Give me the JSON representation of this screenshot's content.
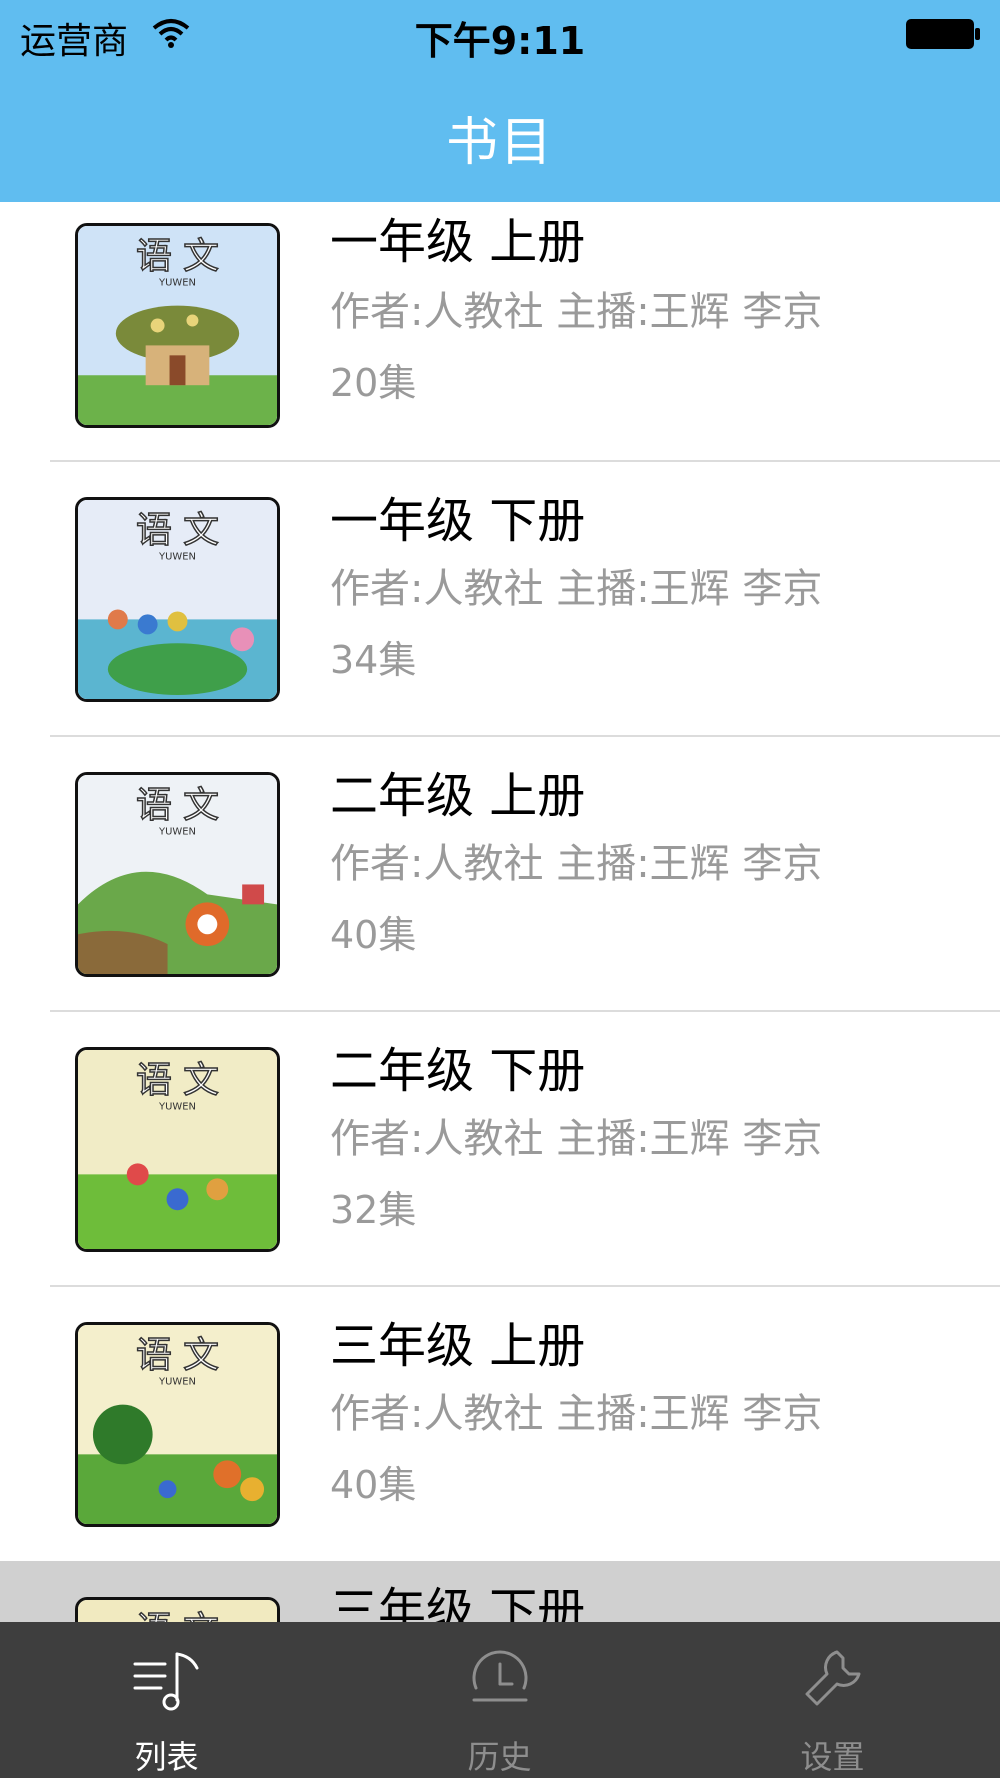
{
  "status_bar": {
    "carrier": "运营商",
    "time": "下午9:11"
  },
  "nav": {
    "title": "书目"
  },
  "books": [
    {
      "title": "一年级 上册",
      "meta": "作者:人教社  主播:王辉 李京",
      "episodes": "20集"
    },
    {
      "title": "一年级 下册",
      "meta": "作者:人教社  主播:王辉 李京",
      "episodes": "34集"
    },
    {
      "title": "二年级 上册",
      "meta": "作者:人教社  主播:王辉 李京",
      "episodes": "40集"
    },
    {
      "title": "二年级 下册",
      "meta": "作者:人教社  主播:王辉 李京",
      "episodes": "32集"
    },
    {
      "title": "三年级 上册",
      "meta": "作者:人教社  主播:王辉 李京",
      "episodes": "40集"
    },
    {
      "title": "三年级 下册",
      "meta": "",
      "episodes": ""
    }
  ],
  "cover": {
    "title": "语 文",
    "subtitle": "YUWEN"
  },
  "tabs": [
    {
      "label": "列表",
      "icon": "music-list-icon",
      "active": true
    },
    {
      "label": "历史",
      "icon": "clock-icon",
      "active": false
    },
    {
      "label": "设置",
      "icon": "wrench-icon",
      "active": false
    }
  ],
  "colors": {
    "header": "#60bdf0",
    "tab_bar": "#3e3e3e",
    "meta_text": "#9a9a9a",
    "selected_row": "#d0d0d0"
  }
}
